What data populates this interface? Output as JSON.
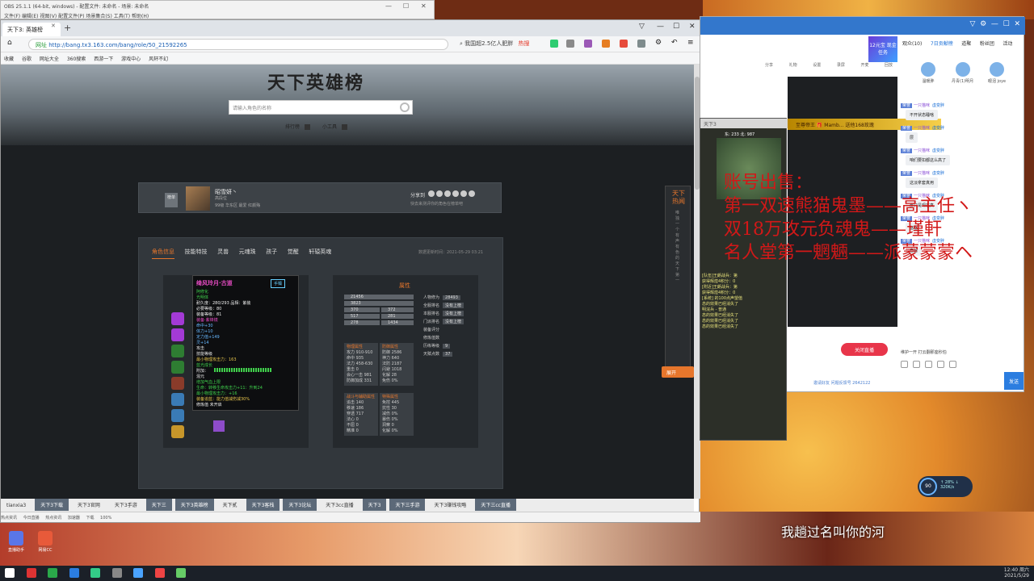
{
  "obs": {
    "title": "OBS 25.1.1 (64-bit, windows) - 配置文件: 未命名 - 场景: 未命名",
    "menu": "文件(F)   编辑(E)   视图(V)   配置文件(P)   场景集合(S)   工具(T)   帮助(H)"
  },
  "browser": {
    "tab_title": "天下3: 英雄榜",
    "url_prefix": "网址",
    "url": "http://bang.tx3.163.com/bang/role/50_21592265",
    "search_hint": "我国超2.5亿人肥胖",
    "search_hot": "热搜",
    "bookmarks": [
      "收藏",
      "谷歌",
      "网址大全",
      "360搜索",
      "西游一下",
      "游戏中心",
      "风轩不幻"
    ],
    "link_bar": [
      {
        "label": "tianxia3",
        "dark": false
      },
      {
        "label": "天下3下载",
        "dark": true
      },
      {
        "label": "天下3官网",
        "dark": false
      },
      {
        "label": "天下3手游",
        "dark": false
      },
      {
        "label": "天下三",
        "dark": true
      },
      {
        "label": "天下3英雄榜",
        "dark": true
      },
      {
        "label": "天下贰",
        "dark": false
      },
      {
        "label": "天下3客栈",
        "dark": true
      },
      {
        "label": "天下3论坛",
        "dark": true
      },
      {
        "label": "天下3cc直播",
        "dark": false
      },
      {
        "label": "天下3",
        "dark": true
      },
      {
        "label": "天下三手游",
        "dark": true
      },
      {
        "label": "天下3赚钱攻略",
        "dark": false
      },
      {
        "label": "天下三cc直播",
        "dark": true
      }
    ],
    "status": [
      "热点资讯",
      "今日直播",
      "热点资讯",
      "加速器",
      "下载",
      "100%"
    ]
  },
  "page": {
    "title": "天下英雄榜",
    "search_placeholder": "请输入角色的名称",
    "rank_link": "排行榜",
    "tool_link": "小工具",
    "char": {
      "rank_badge": "榜单",
      "name": "昭雪妍丶",
      "sub": "高段位",
      "server": "99级 华东区 最爱 红颜殇",
      "share_label": "分享到",
      "share_note": "快去来测评你的角色在榜单吧"
    },
    "tabs": [
      "角色信息",
      "技能特技",
      "灵兽",
      "元魂珠",
      "孩子",
      "觉醒",
      "轩辕英魂"
    ],
    "update_time": "数据更新时间：2021-05-29 03:21",
    "tooltip": {
      "title": "绮风玲月·古道",
      "badge": "手镯",
      "lines": [
        "阿修化",
        "光明体",
        "耐久度：280/293      品相：紫装",
        "必要等级：80",
        "装备等级：81",
        "装备·紫锋镜",
        "命中+30",
        "体力+10",
        "定力值+149",
        "灵+14",
        "攻击",
        "技能等级",
        "最小物理攻击力：163",
        "蓝光成长",
        "附加：",
        "混元",
        "增加气血上限",
        "生命：转移生命攻击力+11：升到24",
        "最小物理攻击力：+16",
        "装备追蓝：能力值减伤减30%",
        "修炼值     未开启"
      ]
    },
    "attr": {
      "title": "属性",
      "bars": [
        "21456",
        "3823"
      ],
      "pairs": [
        [
          "370",
          "372"
        ],
        [
          "517",
          "281"
        ],
        [
          "278",
          "1434"
        ]
      ],
      "side": [
        {
          "k": "人物修为",
          "v": "28493"
        },
        {
          "k": "全服排名",
          "v": "没有上榜"
        },
        {
          "k": "本服排名",
          "v": "没有上榜"
        },
        {
          "k": "门派排名",
          "v": "没有上榜"
        },
        {
          "k": "装备评分",
          "v": ""
        },
        {
          "k": "修炼值数",
          "v": ""
        },
        {
          "k": "历练等级",
          "v": "9"
        },
        {
          "k": "天赋点数",
          "v": "37"
        }
      ],
      "box1": {
        "title": "物理属性",
        "lines": [
          "攻力 910-910",
          "命中 935",
          "法力 458-630",
          "重击 0",
          "会心一击 981",
          "防御加成 331"
        ]
      },
      "box2": {
        "title": "防御属性",
        "lines": [
          "防御 2586",
          "神力 640",
          "法防 2187",
          "闪避 1018",
          "化解 28",
          "免伤 0%"
        ]
      },
      "box3": {
        "title": "战斗与辅助属性",
        "lines": [
          "追击 140",
          "移速 186",
          "穿透 717",
          "法心 0",
          "不屈 0",
          "精准 0"
        ]
      },
      "box4": {
        "title": "特殊属性",
        "lines": [
          "免控 445",
          "抗性 30",
          "减伤 0%",
          "暴伤 0%",
          "洞察 0",
          "化解 0%"
        ]
      }
    },
    "hot_title": "天下热闻",
    "hot_body": "唯独一个有声有色的天下第一",
    "expand": "展开"
  },
  "chat": {
    "tabs": [
      "观众(10)",
      "7日贡献榜",
      "道聚",
      "粉丝团",
      "活动"
    ],
    "reward": "12元宝 现金任务",
    "users": [
      "温暖胖",
      "丹青(1)明月",
      "眼泪 joye"
    ],
    "toolbar": [
      "分享",
      "礼物",
      "设置",
      "录屏",
      "开麦",
      "回放"
    ],
    "gift": "至尊帝王 🎁 Mamb... 送他168玫瑰",
    "messages": [
      {
        "lv": "荣誉",
        "name": "一只猫咪",
        "who": "虚变胖",
        "text": "不开状态睡啥"
      },
      {
        "lv": "荣誉",
        "name": "一只猫咪",
        "who": "虚变胖",
        "text": "层"
      },
      {
        "lv": "荣誉",
        "name": "一只猫咪",
        "who": "虚变胖",
        "text": "咱们要扣都这么高了"
      },
      {
        "lv": "荣誉",
        "name": "一只猫咪",
        "who": "虚变胖",
        "text": "这淡拿套真用"
      },
      {
        "lv": "荣誉",
        "name": "一只猫咪",
        "who": "虚变胖",
        "text": "那只是现在真"
      },
      {
        "lv": "荣誉",
        "name": "一只猫咪",
        "who": "虚变胖",
        "text": "悠悠"
      },
      {
        "lv": "荣誉",
        "name": "一只猫咪",
        "who": "虚变胖",
        "text": "自给"
      }
    ],
    "system": "维护一开 打云翻那座秒怕",
    "close_live": "关闭直播",
    "send": "发送",
    "bottom_links": "邀请好友  问题反馈号 2642122"
  },
  "game": {
    "bar": "天下3",
    "coords": "东: 233  北: 987",
    "log": [
      "[队伍]王朗战兵：第",
      "获得辉煌4积分：0",
      "[附近]王朗战兵：第",
      "获得辉煌4积分：0",
      "[系统] 的100点声望值",
      "态的效果已经消失了",
      "明浣兵 - 普通",
      "态的效果已经消失了",
      "态的效果已经消失了",
      "态的效果已经消失了"
    ]
  },
  "overlay": {
    "sale_lines": [
      "账号出售：",
      "第一双速熊猫鬼墨——高主任ヽ",
      "双18万攻元负魂鬼——瑾軒",
      "名人堂第一魍魎——派蒙蒙蒙ヘ"
    ]
  },
  "stream": {
    "fps": "90",
    "info": "↑ 28%\n↓ 320K/s"
  },
  "subtitle": "我趟过名叫你的河",
  "desktop": [
    {
      "label": "直播助手",
      "color": "#5a76e8"
    },
    {
      "label": "网易CC",
      "color": "#e85a3a"
    }
  ],
  "taskbar": {
    "time": "12:40 周六",
    "date": "2021/5/29"
  }
}
